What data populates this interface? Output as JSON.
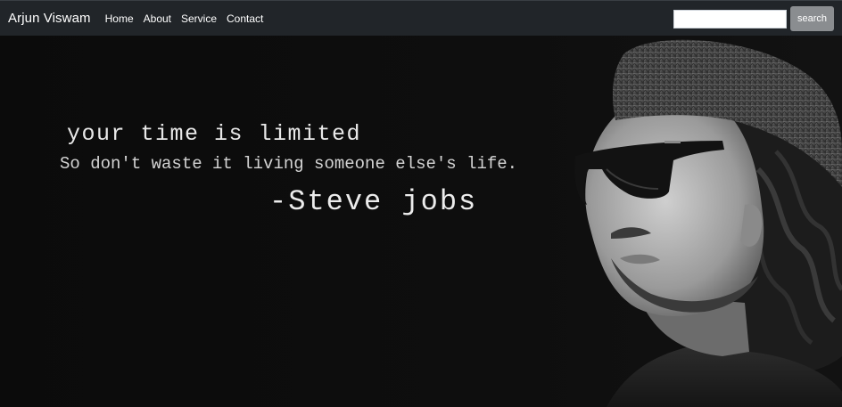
{
  "navbar": {
    "brand": "Arjun Viswam",
    "links": [
      "Home",
      "About",
      "Service",
      "Contact"
    ],
    "search_placeholder": "",
    "search_button": "search"
  },
  "hero": {
    "quote_line1": "your time is limited",
    "quote_line2": "So don't waste it living someone else's life.",
    "quote_author": "-Steve jobs",
    "image": "portrait-photo",
    "background_color": "#0e0e0e"
  },
  "colors": {
    "navbar_bg": "#212529",
    "button_bg": "#8a8d90",
    "text": "#ffffff"
  }
}
